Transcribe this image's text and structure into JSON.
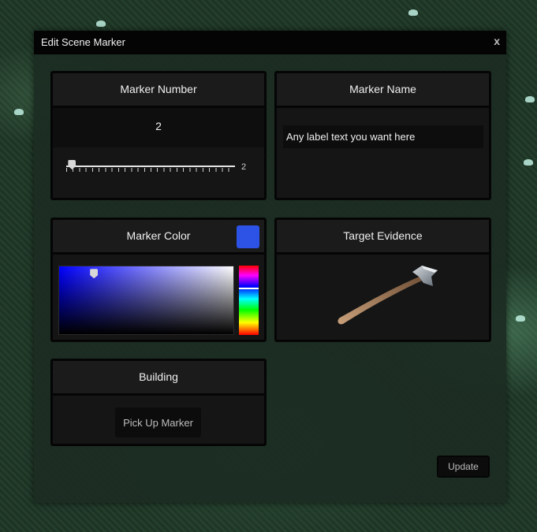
{
  "dialog": {
    "title": "Edit Scene Marker",
    "close_label": "x"
  },
  "marker_number": {
    "header": "Marker Number",
    "value": "2",
    "slider_value": "2",
    "slider_min": 1,
    "slider_max": 30
  },
  "marker_name": {
    "header": "Marker Name",
    "value": "Any label text you want here",
    "placeholder": ""
  },
  "marker_color": {
    "header": "Marker Color",
    "selected_color": "#2c52e6",
    "picker_base_color": "#0000ff",
    "saturation_fraction": 0.2,
    "brightness_fraction": 0.95,
    "hue_fraction": 0.32
  },
  "target_evidence": {
    "header": "Target Evidence",
    "item_icon": "axe-icon"
  },
  "building": {
    "header": "Building",
    "pickup_label": "Pick Up Marker"
  },
  "footer": {
    "update_label": "Update"
  }
}
